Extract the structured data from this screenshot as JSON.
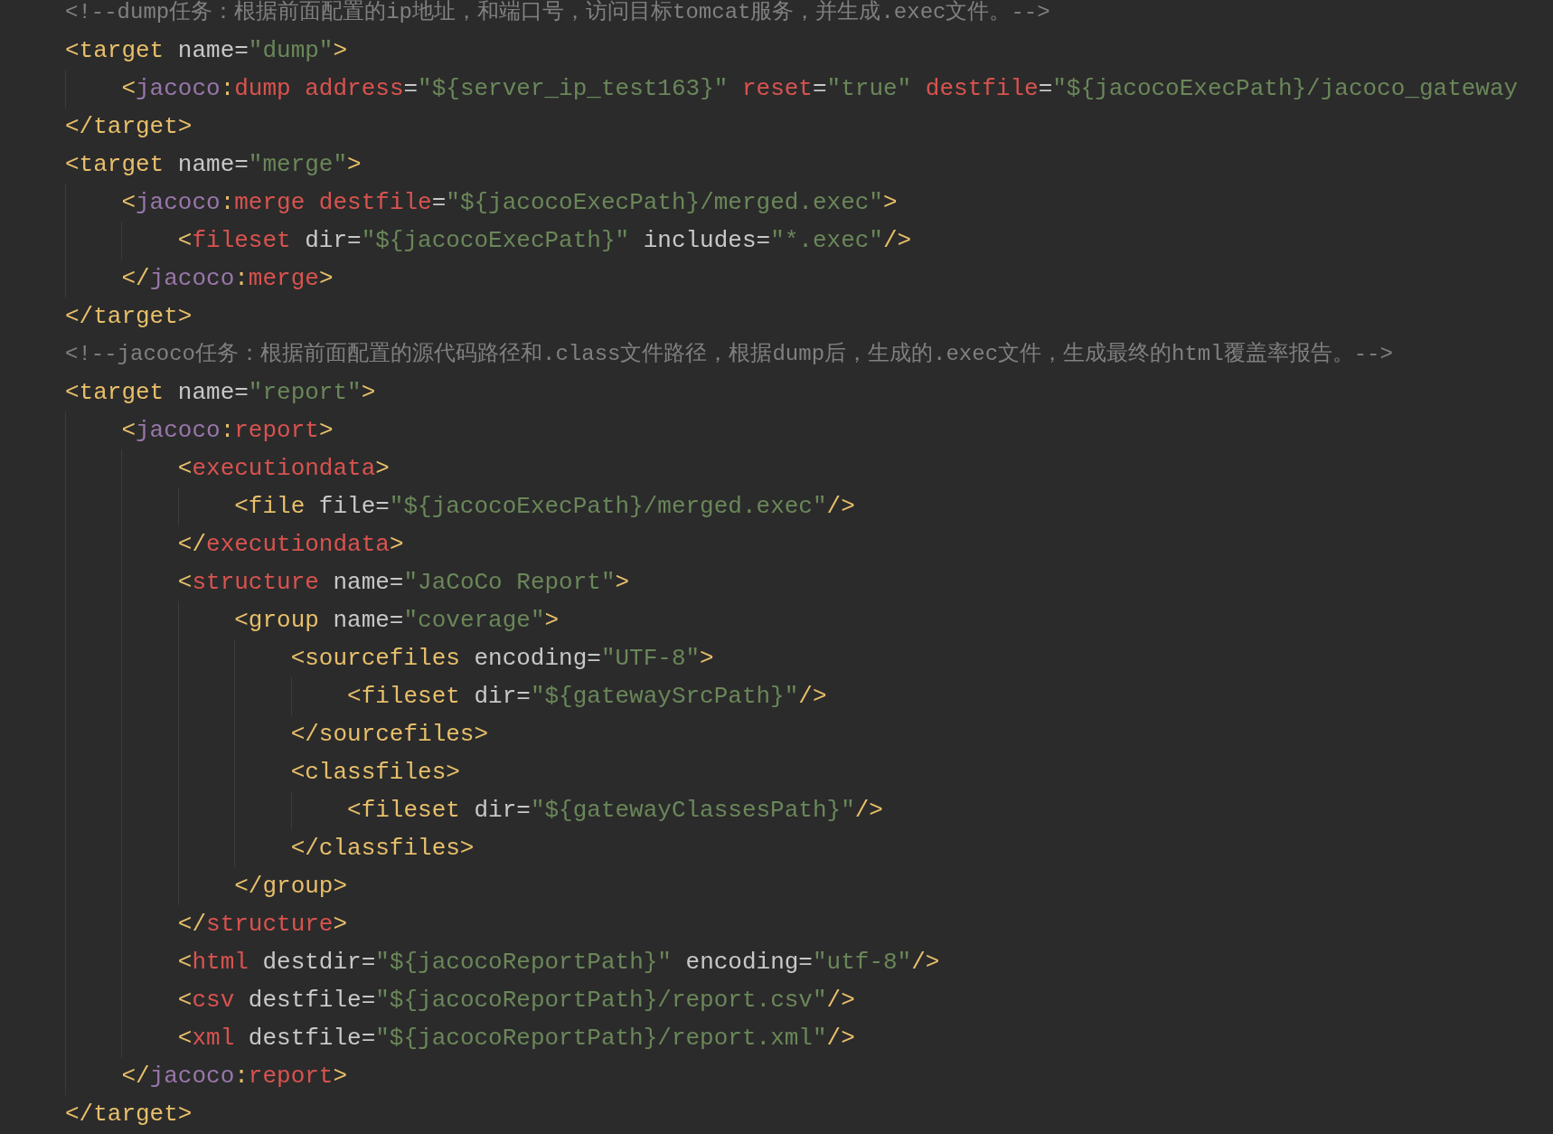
{
  "editor": {
    "lines": [
      {
        "tokens": [
          {
            "kind": "comment",
            "text": "<!--dump任务：根据前面配置的ip地址，和端口号，访问目标tomcat服务，并生成.exec文件。-->"
          }
        ]
      },
      {
        "tokens": [
          {
            "kind": "tag",
            "text": "<target"
          },
          {
            "kind": "attr",
            "text": " name="
          },
          {
            "kind": "value",
            "text": "\"dump\""
          },
          {
            "kind": "tag",
            "text": ">"
          }
        ],
        "children": [
          {
            "tokens": [
              {
                "kind": "tag",
                "text": "<"
              },
              {
                "kind": "ns",
                "text": "jacoco"
              },
              {
                "kind": "tag",
                "text": ":"
              },
              {
                "kind": "red",
                "text": "dump address"
              },
              {
                "kind": "attr",
                "text": "="
              },
              {
                "kind": "value",
                "text": "\"${server_ip_test163}\""
              },
              {
                "kind": "red",
                "text": " reset"
              },
              {
                "kind": "attr",
                "text": "="
              },
              {
                "kind": "value",
                "text": "\"true\""
              },
              {
                "kind": "red",
                "text": " destfile"
              },
              {
                "kind": "attr",
                "text": "="
              },
              {
                "kind": "value",
                "text": "\"${jacocoExecPath}/jacoco_gateway"
              }
            ]
          }
        ]
      },
      {
        "tokens": [
          {
            "kind": "tag",
            "text": "</target>"
          }
        ]
      },
      {
        "tokens": [
          {
            "kind": "tag",
            "text": "<target"
          },
          {
            "kind": "attr",
            "text": " name="
          },
          {
            "kind": "value",
            "text": "\"merge\""
          },
          {
            "kind": "tag",
            "text": ">"
          }
        ],
        "children": [
          {
            "tokens": [
              {
                "kind": "tag",
                "text": "<"
              },
              {
                "kind": "ns",
                "text": "jacoco"
              },
              {
                "kind": "tag",
                "text": ":"
              },
              {
                "kind": "red",
                "text": "merge destfile"
              },
              {
                "kind": "attr",
                "text": "="
              },
              {
                "kind": "value",
                "text": "\"${jacocoExecPath}/merged.exec\""
              },
              {
                "kind": "tag",
                "text": ">"
              }
            ],
            "children": [
              {
                "tokens": [
                  {
                    "kind": "tag",
                    "text": "<"
                  },
                  {
                    "kind": "red",
                    "text": "fileset"
                  },
                  {
                    "kind": "attr",
                    "text": " dir="
                  },
                  {
                    "kind": "value",
                    "text": "\"${jacocoExecPath}\""
                  },
                  {
                    "kind": "attr",
                    "text": " includes="
                  },
                  {
                    "kind": "value",
                    "text": "\"*.exec\""
                  },
                  {
                    "kind": "tag",
                    "text": "/>"
                  }
                ]
              }
            ]
          },
          {
            "tokens": [
              {
                "kind": "tag",
                "text": "</"
              },
              {
                "kind": "ns",
                "text": "jacoco"
              },
              {
                "kind": "tag",
                "text": ":"
              },
              {
                "kind": "red",
                "text": "merge"
              },
              {
                "kind": "tag",
                "text": ">"
              }
            ]
          }
        ]
      },
      {
        "tokens": [
          {
            "kind": "tag",
            "text": "</target>"
          }
        ]
      },
      {
        "tokens": [
          {
            "kind": "comment",
            "text": "<!--jacoco任务：根据前面配置的源代码路径和.class文件路径，根据dump后，生成的.exec文件，生成最终的html覆盖率报告。-->"
          }
        ]
      },
      {
        "tokens": [
          {
            "kind": "tag",
            "text": "<target"
          },
          {
            "kind": "attr",
            "text": " name="
          },
          {
            "kind": "value",
            "text": "\"report\""
          },
          {
            "kind": "tag",
            "text": ">"
          }
        ],
        "children": [
          {
            "tokens": [
              {
                "kind": "tag",
                "text": "<"
              },
              {
                "kind": "ns",
                "text": "jacoco"
              },
              {
                "kind": "tag",
                "text": ":"
              },
              {
                "kind": "red",
                "text": "report"
              },
              {
                "kind": "tag",
                "text": ">"
              }
            ],
            "children": [
              {
                "tokens": [
                  {
                    "kind": "tag",
                    "text": "<"
                  },
                  {
                    "kind": "red",
                    "text": "executiondata"
                  },
                  {
                    "kind": "tag",
                    "text": ">"
                  }
                ],
                "children": [
                  {
                    "tokens": [
                      {
                        "kind": "tag",
                        "text": "<file"
                      },
                      {
                        "kind": "attr",
                        "text": " file="
                      },
                      {
                        "kind": "value",
                        "text": "\"${jacocoExecPath}/merged.exec\""
                      },
                      {
                        "kind": "tag",
                        "text": "/>"
                      }
                    ]
                  }
                ]
              },
              {
                "tokens": [
                  {
                    "kind": "tag",
                    "text": "</"
                  },
                  {
                    "kind": "red",
                    "text": "executiondata"
                  },
                  {
                    "kind": "tag",
                    "text": ">"
                  }
                ]
              },
              {
                "tokens": [
                  {
                    "kind": "tag",
                    "text": "<"
                  },
                  {
                    "kind": "red",
                    "text": "structure"
                  },
                  {
                    "kind": "attr",
                    "text": " name="
                  },
                  {
                    "kind": "value",
                    "text": "\"JaCoCo Report\""
                  },
                  {
                    "kind": "tag",
                    "text": ">"
                  }
                ],
                "children": [
                  {
                    "tokens": [
                      {
                        "kind": "tag",
                        "text": "<group"
                      },
                      {
                        "kind": "attr",
                        "text": " name="
                      },
                      {
                        "kind": "value",
                        "text": "\"coverage\""
                      },
                      {
                        "kind": "tag",
                        "text": ">"
                      }
                    ],
                    "children": [
                      {
                        "tokens": [
                          {
                            "kind": "tag",
                            "text": "<sourcefiles"
                          },
                          {
                            "kind": "attr",
                            "text": " encoding="
                          },
                          {
                            "kind": "value",
                            "text": "\"UTF-8\""
                          },
                          {
                            "kind": "tag",
                            "text": ">"
                          }
                        ],
                        "children": [
                          {
                            "tokens": [
                              {
                                "kind": "tag",
                                "text": "<fileset"
                              },
                              {
                                "kind": "attr",
                                "text": " dir="
                              },
                              {
                                "kind": "value",
                                "text": "\"${gatewaySrcPath}\""
                              },
                              {
                                "kind": "tag",
                                "text": "/>"
                              }
                            ]
                          }
                        ]
                      },
                      {
                        "tokens": [
                          {
                            "kind": "tag",
                            "text": "</sourcefiles>"
                          }
                        ]
                      },
                      {
                        "tokens": [
                          {
                            "kind": "tag",
                            "text": "<classfiles>"
                          }
                        ],
                        "children": [
                          {
                            "tokens": [
                              {
                                "kind": "tag",
                                "text": "<fileset"
                              },
                              {
                                "kind": "attr",
                                "text": " dir="
                              },
                              {
                                "kind": "value",
                                "text": "\"${gatewayClassesPath}\""
                              },
                              {
                                "kind": "tag",
                                "text": "/>"
                              }
                            ]
                          }
                        ]
                      },
                      {
                        "tokens": [
                          {
                            "kind": "tag",
                            "text": "</classfiles>"
                          }
                        ]
                      }
                    ]
                  },
                  {
                    "tokens": [
                      {
                        "kind": "tag",
                        "text": "</group>"
                      }
                    ]
                  }
                ]
              },
              {
                "tokens": [
                  {
                    "kind": "tag",
                    "text": "</"
                  },
                  {
                    "kind": "red",
                    "text": "structure"
                  },
                  {
                    "kind": "tag",
                    "text": ">"
                  }
                ]
              },
              {
                "tokens": [
                  {
                    "kind": "tag",
                    "text": "<"
                  },
                  {
                    "kind": "red",
                    "text": "html"
                  },
                  {
                    "kind": "attr",
                    "text": " destdir="
                  },
                  {
                    "kind": "value",
                    "text": "\"${jacocoReportPath}\""
                  },
                  {
                    "kind": "attr",
                    "text": " encoding="
                  },
                  {
                    "kind": "value",
                    "text": "\"utf-8\""
                  },
                  {
                    "kind": "tag",
                    "text": "/>"
                  }
                ]
              },
              {
                "tokens": [
                  {
                    "kind": "tag",
                    "text": "<"
                  },
                  {
                    "kind": "red",
                    "text": "csv"
                  },
                  {
                    "kind": "attr",
                    "text": " destfile="
                  },
                  {
                    "kind": "value",
                    "text": "\"${jacocoReportPath}/report.csv\""
                  },
                  {
                    "kind": "tag",
                    "text": "/>"
                  }
                ]
              },
              {
                "tokens": [
                  {
                    "kind": "tag",
                    "text": "<"
                  },
                  {
                    "kind": "red",
                    "text": "xml"
                  },
                  {
                    "kind": "attr",
                    "text": " destfile="
                  },
                  {
                    "kind": "value",
                    "text": "\"${jacocoReportPath}/report.xml\""
                  },
                  {
                    "kind": "tag",
                    "text": "/>"
                  }
                ]
              }
            ]
          },
          {
            "tokens": [
              {
                "kind": "tag",
                "text": "</"
              },
              {
                "kind": "ns",
                "text": "jacoco"
              },
              {
                "kind": "tag",
                "text": ":"
              },
              {
                "kind": "red",
                "text": "report"
              },
              {
                "kind": "tag",
                "text": ">"
              }
            ]
          }
        ]
      },
      {
        "tokens": [
          {
            "kind": "tag",
            "text": "</target>"
          }
        ]
      }
    ]
  }
}
